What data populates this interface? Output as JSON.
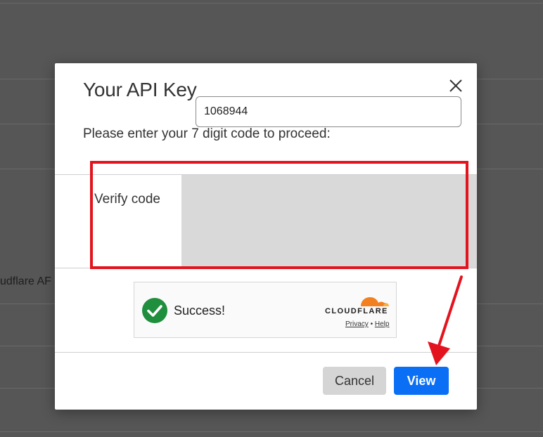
{
  "background": {
    "partial_text": "udflare AF"
  },
  "modal": {
    "title": "Your API Key",
    "subtitle": "Please enter your 7 digit code to proceed:",
    "verify_label": "Verify code",
    "code_value": "1068944",
    "captcha": {
      "status_text": "Success!",
      "brand": "CLOUDFLARE",
      "privacy_link": "Privacy",
      "separator": "•",
      "help_link": "Help",
      "brand_color": "#f38020",
      "success_color": "#1f8e3d"
    },
    "cancel_label": "Cancel",
    "view_label": "View"
  },
  "colors": {
    "accent_blue": "#0a6ff5",
    "highlight_red": "#e3141e",
    "overlay": "#565656"
  },
  "icons": {
    "close": "close-icon",
    "success": "check-circle-icon",
    "cloud": "cloudflare-cloud-icon",
    "annotation": "red-arrow-icon"
  }
}
